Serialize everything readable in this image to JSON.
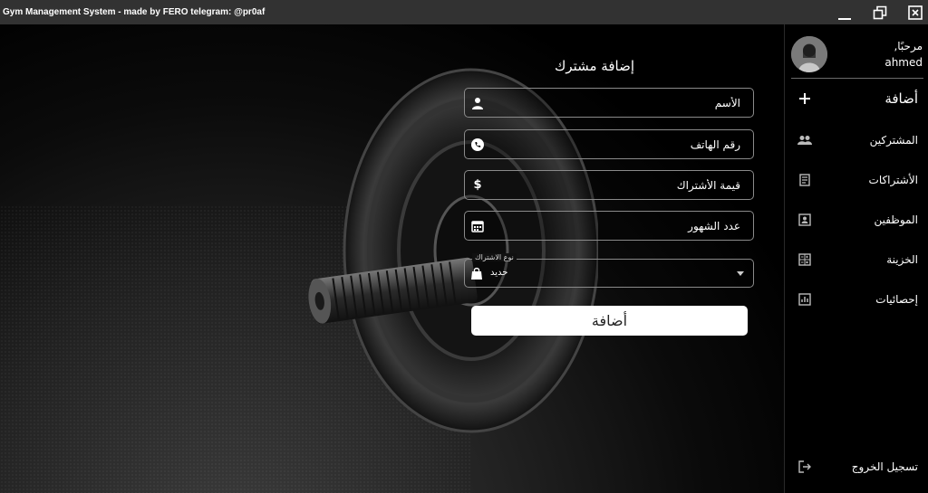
{
  "window": {
    "title": "Gym Management System - made by FERO telegram: @pr0af"
  },
  "page": {
    "title": "إضافة مشترك"
  },
  "form": {
    "name_placeholder": "الأسم",
    "phone_placeholder": "رقم الهاتف",
    "price_placeholder": "قيمة الأشتراك",
    "months_placeholder": "عدد الشهور",
    "type_label": "نوع الاشتراك",
    "type_value": "حديد",
    "submit_label": "أضافة"
  },
  "user": {
    "greeting": "مرحبًا,",
    "name": "ahmed"
  },
  "sidebar": {
    "items": [
      {
        "label": "أضافة",
        "icon": "plus-icon"
      },
      {
        "label": "المشتركين",
        "icon": "users-icon"
      },
      {
        "label": "الأشتراكات",
        "icon": "receipt-icon"
      },
      {
        "label": "الموظفين",
        "icon": "badge-icon"
      },
      {
        "label": "الخزينة",
        "icon": "calculator-icon"
      },
      {
        "label": "إحصائيات",
        "icon": "chart-icon"
      }
    ],
    "logout_label": "تسجيل الخروج"
  }
}
